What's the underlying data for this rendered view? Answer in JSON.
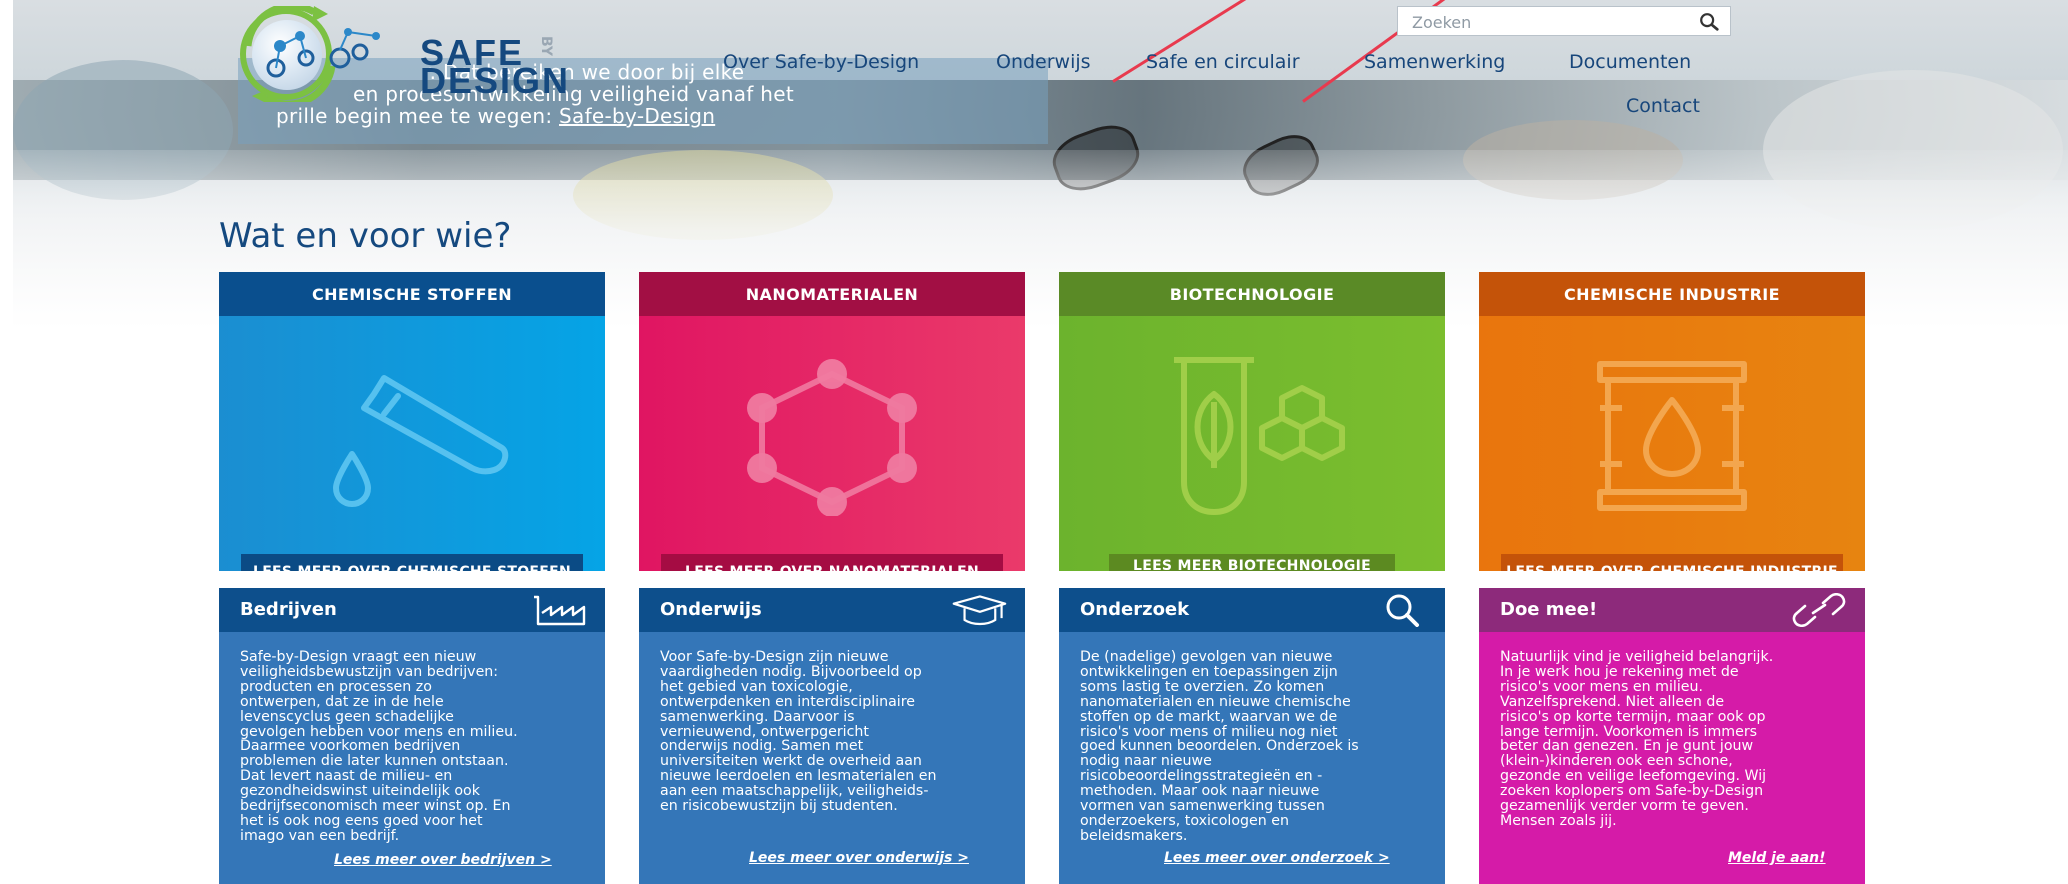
{
  "header": {
    "logo": {
      "line1": "SAFE",
      "line2": "DESIGN",
      "by": "BY"
    },
    "search": {
      "placeholder": "Zoeken",
      "icon": "search-icon"
    },
    "nav": [
      {
        "label": "Over Safe-by-Design"
      },
      {
        "label": "Onderwijs"
      },
      {
        "label": "Safe en circulair"
      },
      {
        "label": "Samenwerking"
      },
      {
        "label": "Documenten"
      },
      {
        "label": "Contact"
      }
    ]
  },
  "intro": {
    "line1": "r. Dat bereiken we door bij elke",
    "line2": "en procesontwikkeling veiligheid vanaf het",
    "line3_text": "prille begin mee te wegen: ",
    "line3_link": "Safe-by-Design"
  },
  "section_title": "Wat en voor wie?",
  "categories": [
    {
      "title": "CHEMISCHE STOFFEN",
      "more": "LEES MEER OVER CHEMISCHE STOFFEN",
      "icon": "test-tube-drop-icon",
      "colors": {
        "head": "#0a4f8e",
        "body_from": "#1b8ed1",
        "body_to": "#05a4e6",
        "button": "#0b4b85"
      }
    },
    {
      "title": "NANOMATERIALEN",
      "more": "LEES MEER OVER NANOMATERIALEN",
      "icon": "hexagon-molecule-icon",
      "colors": {
        "head": "#a20f44",
        "body_from": "#e01562",
        "body_to": "#ea3a6a",
        "button": "#a50c43"
      }
    },
    {
      "title": "BIOTECHNOLOGIE",
      "more": "LEES MEER BIOTECHNOLOGIE",
      "icon": "leaf-tube-icon",
      "colors": {
        "head": "#5a8a26",
        "body_from": "#6cb32d",
        "body_to": "#7bbe2e",
        "button": "#5c8a21"
      }
    },
    {
      "title": "CHEMISCHE INDUSTRIE",
      "more": "LEES MEER OVER CHEMISCHE INDUSTRIE",
      "icon": "barrel-drop-icon",
      "colors": {
        "head": "#c45309",
        "body_from": "#e9750d",
        "body_to": "#e78410",
        "button": "#c45309"
      }
    }
  ],
  "info": [
    {
      "title": "Bedrijven",
      "icon": "factory-icon",
      "colors": {
        "head": "#0d4f8c",
        "body": "#3476b8"
      },
      "lines": [
        "Safe-by-Design vraagt een nieuw",
        "veiligheidsbewustzijn van bedrijven:",
        "producten en processen zo",
        "ontwerpen, dat ze in de hele",
        "levenscyclus geen schadelijke",
        "gevolgen hebben voor mens en milieu.",
        "Daarmee voorkomen bedrijven",
        "problemen die later kunnen ontstaan.",
        "Dat levert naast de milieu- en",
        "gezondheidswinst uiteindelijk ook",
        "bedrijfseconomisch meer winst op. En",
        "het is ook nog eens goed voor het",
        "imago van een bedrijf."
      ],
      "link": "Lees meer over bedrijven >"
    },
    {
      "title": "Onderwijs",
      "icon": "graduation-cap-icon",
      "colors": {
        "head": "#0d4f8c",
        "body": "#3476b8"
      },
      "lines": [
        "Voor Safe-by-Design zijn nieuwe",
        "vaardigheden nodig. Bijvoorbeeld op",
        "het gebied van toxicologie,",
        "ontwerpdenken en interdisciplinaire",
        "samenwerking. Daarvoor is",
        "vernieuwend, ontwerpgericht",
        "onderwijs nodig. Samen met",
        "universiteiten werkt de overheid aan",
        "nieuwe leerdoelen en lesmaterialen en",
        "aan een maatschappelijk, veiligheids-",
        "en risicobewustzijn bij studenten."
      ],
      "link": "Lees meer over onderwijs >"
    },
    {
      "title": "Onderzoek",
      "icon": "magnifier-icon",
      "colors": {
        "head": "#0d4f8c",
        "body": "#3476b8"
      },
      "lines": [
        "De (nadelige) gevolgen van nieuwe",
        "ontwikkelingen en toepassingen zijn",
        "soms lastig te overzien. Zo komen",
        "nanomaterialen en nieuwe chemische",
        "stoffen op de markt, waarvan we de",
        "risico's voor mens of milieu nog niet",
        "goed kunnen beoordelen. Onderzoek is",
        "nodig naar nieuwe",
        "risicobeoordelingsstrategieën en -",
        "methoden. Maar ook naar nieuwe",
        "vormen van samenwerking tussen",
        "onderzoekers, toxicologen en",
        "beleidsmakers."
      ],
      "link": "Lees meer over onderzoek >"
    },
    {
      "title": "Doe mee!",
      "icon": "link-icon",
      "colors": {
        "head": "#8d2a7b",
        "body": "#d51ba8"
      },
      "lines": [
        "Natuurlijk vind je veiligheid belangrijk.",
        "In je werk hou je rekening met de",
        "risico's voor mens en milieu.",
        "Vanzelfsprekend. Niet alleen de",
        "risico's op korte termijn, maar ook op",
        "lange termijn. Voorkomen is immers",
        "beter dan genezen. En je gunt jouw",
        "(klein-)kinderen ook een schone,",
        "gezonde en veilige leefomgeving. Wij",
        "zoeken koplopers om Safe-by-Design",
        "gezamenlijk verder vorm te geven.",
        "Mensen zoals jij."
      ],
      "link": "Meld je aan!"
    }
  ]
}
